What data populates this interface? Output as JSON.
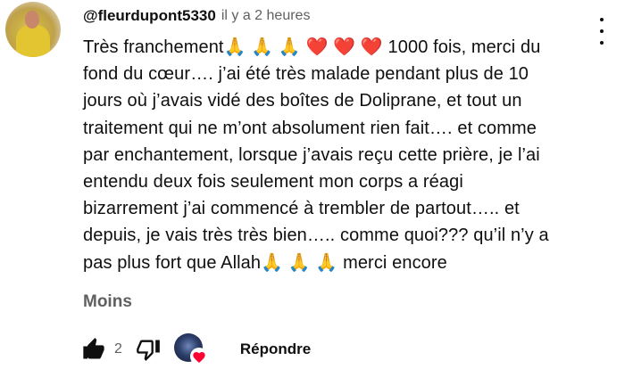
{
  "comment": {
    "author": "@fleurdupont5330",
    "timestamp": "il y a 2 heures",
    "lines": [
      "Très franchement🙏 🙏 🙏 ❤️ ❤️ ❤️  1000 fois, merci du",
      "fond du cœur…. j’ai été très malade pendant plus de 10",
      "jours où j’avais vidé des boîtes de Doliprane, et tout un",
      "traitement qui ne m’ont absolument rien fait…. et comme",
      "par enchantement, lorsque j’avais reçu cette prière, je l’ai",
      "entendu deux fois seulement mon corps a réagi",
      "bizarrement j’ai commencé à trembler de partout….. et",
      "depuis, je vais très très bien….. comme quoi??? qu’il n’y a",
      "pas plus fort que Allah🙏 🙏 🙏  merci encore"
    ],
    "show_less_label": "Moins"
  },
  "actions": {
    "like_count": "2",
    "reply_label": "Répondre",
    "liked": true
  },
  "icons": {
    "menu": "kebab-menu-icon",
    "like": "thumbs-up-filled-icon",
    "dislike": "thumbs-down-icon",
    "creator_heart": "heart-icon"
  },
  "colors": {
    "text": "#0f0f0f",
    "secondary": "#606060",
    "heart": "#ff0033"
  }
}
